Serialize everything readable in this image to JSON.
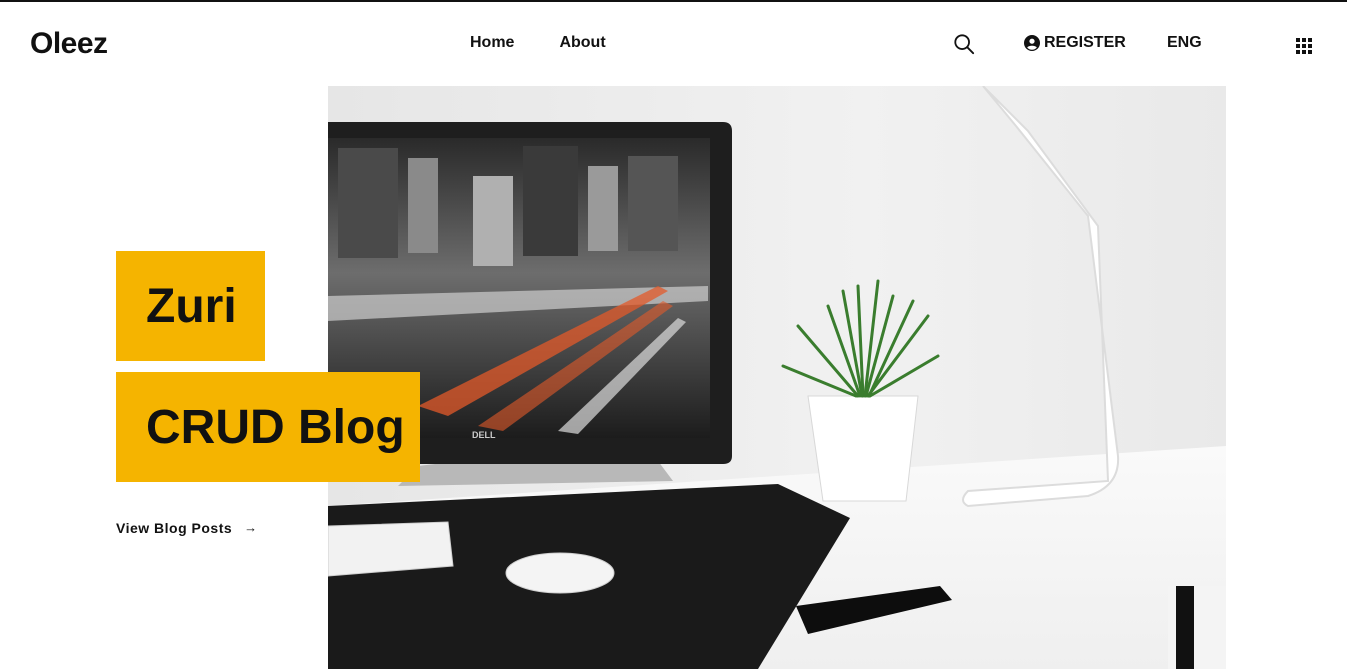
{
  "brand": {
    "logo": "Oleez",
    "accent_color": "#f5b400"
  },
  "nav": {
    "items": [
      {
        "label": "Home",
        "active": true
      },
      {
        "label": "About",
        "active": false
      }
    ]
  },
  "header_actions": {
    "search_icon": "search-icon",
    "register_label": "REGISTER",
    "register_icon": "user-circle-icon",
    "language_label": "ENG",
    "menu_icon": "grid-menu-icon"
  },
  "hero": {
    "title_line_1": "Zuri",
    "title_line_2": "CRUD Blog",
    "cta_label": "View Blog Posts",
    "cta_arrow": "→",
    "image": "desk-workspace-photo"
  }
}
